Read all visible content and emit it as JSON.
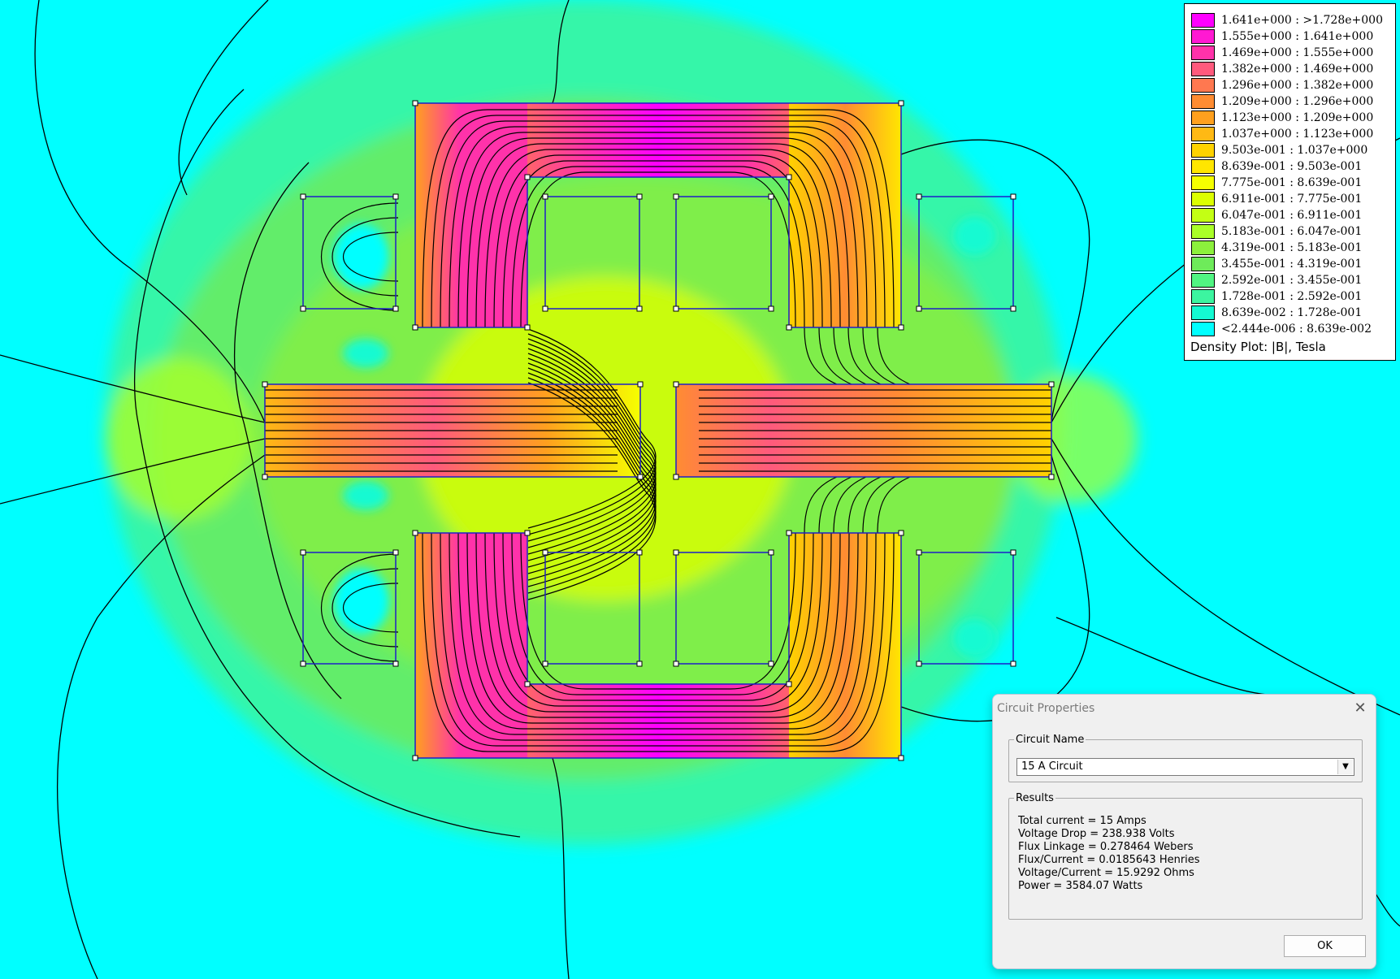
{
  "legend": {
    "items": [
      {
        "label": "1.641e+000 : >1.728e+000",
        "color": "#ff00ff"
      },
      {
        "label": "1.555e+000 : 1.641e+000",
        "color": "#ff19d2"
      },
      {
        "label": "1.469e+000 : 1.555e+000",
        "color": "#ff32aa"
      },
      {
        "label": "1.382e+000 : 1.469e+000",
        "color": "#ff5a7d"
      },
      {
        "label": "1.296e+000 : 1.382e+000",
        "color": "#ff7850"
      },
      {
        "label": "1.209e+000 : 1.296e+000",
        "color": "#ff8c32"
      },
      {
        "label": "1.123e+000 : 1.209e+000",
        "color": "#ffa01e"
      },
      {
        "label": "1.037e+000 : 1.123e+000",
        "color": "#ffb914"
      },
      {
        "label": "9.503e-001 : 1.037e+000",
        "color": "#ffd200"
      },
      {
        "label": "8.639e-001 : 9.503e-001",
        "color": "#ffe600"
      },
      {
        "label": "7.775e-001 : 8.639e-001",
        "color": "#f5ff00"
      },
      {
        "label": "6.911e-001 : 7.775e-001",
        "color": "#dcff00"
      },
      {
        "label": "6.047e-001 : 6.911e-001",
        "color": "#c3ff14"
      },
      {
        "label": "5.183e-001 : 6.047e-001",
        "color": "#aaff28"
      },
      {
        "label": "4.319e-001 : 5.183e-001",
        "color": "#8cf03c"
      },
      {
        "label": "3.455e-001 : 4.319e-001",
        "color": "#6eeb5a"
      },
      {
        "label": "2.592e-001 : 3.455e-001",
        "color": "#50f582"
      },
      {
        "label": "1.728e-001 : 2.592e-001",
        "color": "#3cf5a0"
      },
      {
        "label": "8.639e-002 : 1.728e-001",
        "color": "#14fad2"
      },
      {
        "label": "<2.444e-006 : 8.639e-002",
        "color": "#00ffff"
      }
    ],
    "caption": "Density Plot: |B|, Tesla"
  },
  "dialog": {
    "title": "Circuit Properties",
    "close_icon": "close-icon",
    "circuit_group_label": "Circuit Name",
    "circuit_selected": "15 A Circuit",
    "results_group_label": "Results",
    "results": [
      "Total current = 15 Amps",
      "Voltage Drop = 238.938 Volts",
      "Flux Linkage = 0.278464 Webers",
      "Flux/Current = 0.0185643 Henries",
      "Voltage/Current = 15.9292 Ohms",
      "Power = 3584.07 Watts"
    ],
    "ok_label": "OK"
  }
}
